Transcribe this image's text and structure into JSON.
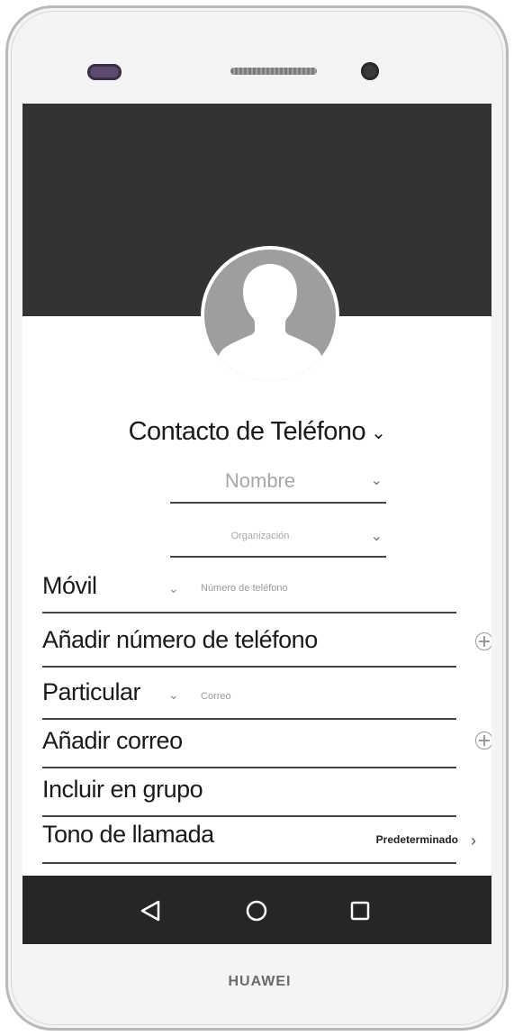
{
  "device": {
    "brand": "HUAWEI"
  },
  "contact": {
    "account_type": "Contacto de Teléfono",
    "name_placeholder": "Nombre",
    "organization_placeholder": "Organización"
  },
  "phone": {
    "type_label": "Móvil",
    "number_placeholder": "Número de teléfono",
    "add_label": "Añadir número de teléfono"
  },
  "email": {
    "type_label": "Particular",
    "placeholder": "Correo",
    "add_label": "Añadir correo"
  },
  "group": {
    "label": "Incluir en grupo"
  },
  "ringtone": {
    "label": "Tono de llamada",
    "value": "Predeterminado"
  },
  "icons": {
    "avatar": "person-silhouette-icon",
    "dropdown": "chevron-down-icon",
    "add": "plus-circle-icon",
    "arrow": "chevron-right-icon",
    "back": "back-triangle-icon",
    "home": "home-circle-icon",
    "recents": "recents-square-icon"
  },
  "colors": {
    "header": "#333333",
    "navbar": "#262626",
    "avatar": "#9e9e9e"
  }
}
